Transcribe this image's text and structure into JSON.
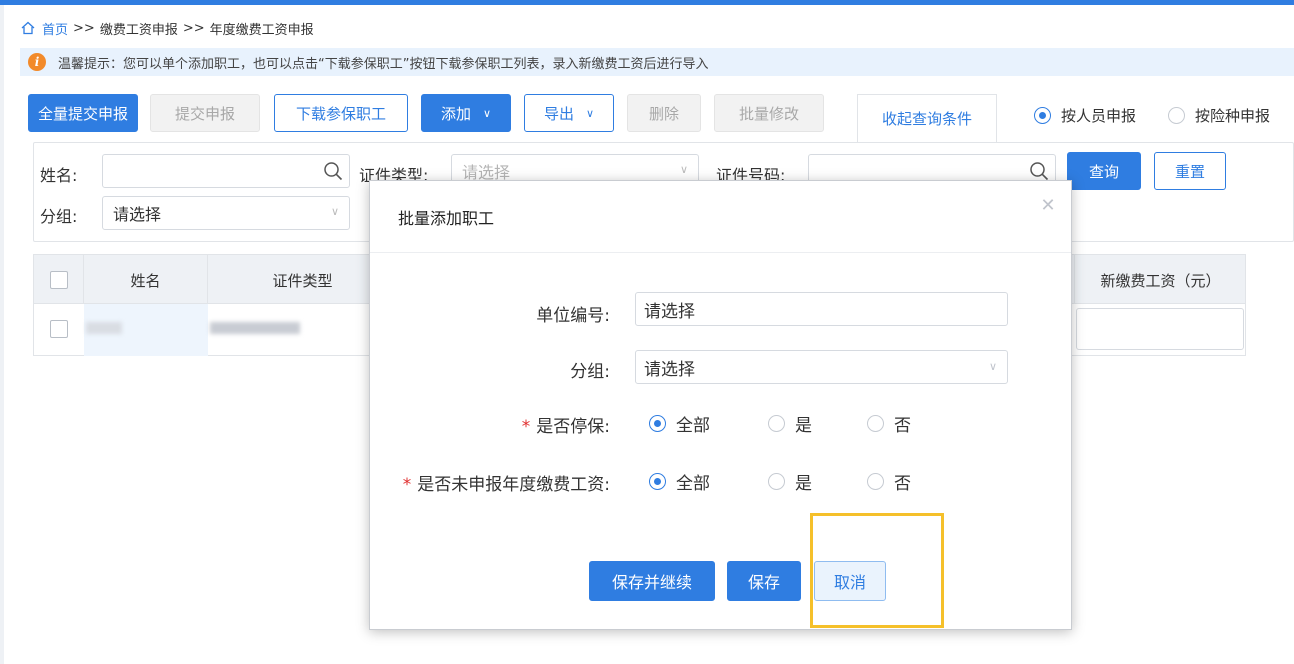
{
  "breadcrumb": {
    "home": "首页",
    "sep": ">>",
    "level1": "缴费工资申报",
    "level2": "年度缴费工资申报"
  },
  "tip": {
    "icon": "info-icon",
    "text": "温馨提示：您可以单个添加职工，也可以点击“下载参保职工”按钮下载参保职工列表，录入新缴费工资后进行导入"
  },
  "toolbar": {
    "submit_all": "全量提交申报",
    "submit": "提交申报",
    "download_staff": "下载参保职工",
    "add": "添加",
    "export": "导出",
    "delete": "删除",
    "batch_edit": "批量修改",
    "collapse_query": "收起查询条件",
    "mode_person": "按人员申报",
    "mode_insurance": "按险种申报",
    "mode_selected": "按人员申报"
  },
  "filters": {
    "name_label": "姓名:",
    "name_value": "",
    "id_type_label": "证件类型:",
    "id_type_placeholder": "请选择",
    "id_no_label": "证件号码:",
    "id_no_value": "",
    "group_label": "分组:",
    "group_value": "请选择",
    "query_button": "查询",
    "reset_button": "重置"
  },
  "table": {
    "columns": [
      "姓名",
      "证件类型",
      "新缴费工资（元）"
    ],
    "rows": [
      {
        "name": "",
        "id_type": "",
        "new_wage": ""
      }
    ]
  },
  "modal": {
    "title": "批量添加职工",
    "unit_no_label": "单位编号:",
    "unit_no_value": "请选择",
    "group_label": "分组:",
    "group_value": "请选择",
    "suspended_label": "是否停保:",
    "suspended_options": [
      "全部",
      "是",
      "否"
    ],
    "suspended_selected": "全部",
    "unreported_label": "是否未申报年度缴费工资:",
    "unreported_options": [
      "全部",
      "是",
      "否"
    ],
    "unreported_selected": "全部",
    "required_mark": "*",
    "save_continue": "保存并继续",
    "save": "保存",
    "cancel": "取消"
  },
  "colors": {
    "accent": "#2f7de1",
    "highlight": "#f5c02a",
    "tip_bg": "#e8f2fd",
    "required": "#e02e2e"
  }
}
